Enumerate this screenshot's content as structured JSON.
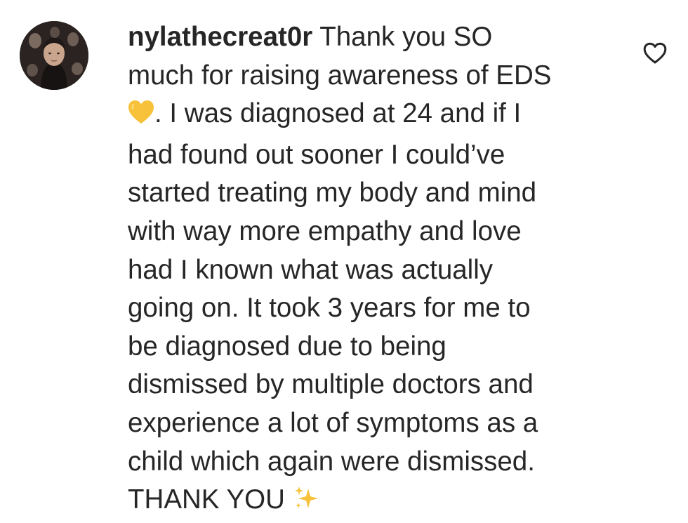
{
  "comment": {
    "username": "nylathecreat0r",
    "lines": [
      "Thank you SO",
      "much for raising awareness of EDS",
      ". I was diagnosed at 24 and if I",
      "had found out sooner I could’ve",
      "started treating my body and mind",
      "with way more empathy and love",
      "had I known what was actually",
      "going on. It took 3 years for me to",
      "be diagnosed due to being",
      "dismissed by multiple doctors and",
      "experience a lot of symptoms as a",
      "child which again were dismissed.",
      "THANK YOU"
    ],
    "emojis": {
      "heart": "yellow-heart-emoji",
      "sparkles": "sparkles-emoji"
    }
  },
  "colors": {
    "text": "#262626",
    "background": "#ffffff",
    "icon_stroke": "#262626",
    "emoji_yellow": "#f7c23a"
  }
}
